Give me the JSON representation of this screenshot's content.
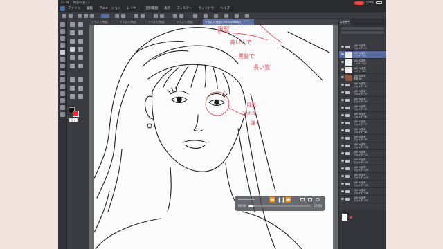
{
  "status_bar": {
    "time": "23:24",
    "date": "9月25日(土)",
    "battery": "100%"
  },
  "menu": [
    "ファイル",
    "編集",
    "アニメーション",
    "レイヤー",
    "選択範囲",
    "表示",
    "フィルター",
    "ウィンドウ",
    "ヘルプ"
  ],
  "tabs": [
    {
      "label": "イラスト(完成)"
    },
    {
      "label": "イラスト(完成)"
    },
    {
      "label": "イラスト(完成)"
    },
    {
      "label": "イラスト(完成)"
    },
    {
      "label": "イラスト(完成)(1920x1080px)"
    }
  ],
  "palette": {
    "tabs": [
      "レイヤー",
      "",
      "",
      ""
    ]
  },
  "layers": [
    {
      "line1": "100 % 通常",
      "line2": "フォルダー 1",
      "type": "folder",
      "selected": false
    },
    {
      "line1": "100 % 通常",
      "line2": "レイヤー 24",
      "type": "layer",
      "selected": true
    },
    {
      "line1": "100 % 通常",
      "line2": "レイヤー 23",
      "type": "layer",
      "selected": false
    },
    {
      "line1": "100 % 通常",
      "line2": "レイヤー 22",
      "type": "layer",
      "selected": false
    },
    {
      "line1": "100 % 通常",
      "line2": "写真 16",
      "type": "photo",
      "selected": false
    },
    {
      "line1": "100 % 通常",
      "line2": "フォルダー 2",
      "type": "folder",
      "selected": false
    },
    {
      "line1": "100 % 通常",
      "line2": "フォルダー 3",
      "type": "folder",
      "selected": false
    },
    {
      "line1": "100 % 通常",
      "line2": "フォルダー 4",
      "type": "folder",
      "selected": false
    },
    {
      "line1": "100 % 通常",
      "line2": "フォルダー 5",
      "type": "folder",
      "selected": false
    },
    {
      "line1": "100 % 通常",
      "line2": "フォルダー 6",
      "type": "folder",
      "selected": false
    },
    {
      "line1": "100 % 通常",
      "line2": "フォルダー 7",
      "type": "folder",
      "selected": false
    },
    {
      "line1": "100 % 通常",
      "line2": "フォルダー 8",
      "type": "folder",
      "selected": false
    },
    {
      "line1": "100 % 通常",
      "line2": "フォルダー 9",
      "type": "folder",
      "selected": false
    },
    {
      "line1": "100 % 通常",
      "line2": "フォルダー 10",
      "type": "folder",
      "selected": false
    },
    {
      "line1": "100 % 通常",
      "line2": "フォルダー 11",
      "type": "folder",
      "selected": false
    },
    {
      "line1": "100 % 通常",
      "line2": "フォルダー 12",
      "type": "folder",
      "selected": false
    },
    {
      "line1": "100 % 通常",
      "line2": "フォルダー 13",
      "type": "folder",
      "selected": false
    },
    {
      "line1": "100 % 通常",
      "line2": "フォルダー 14",
      "type": "folder",
      "selected": false
    },
    {
      "line1": "100 % 通常",
      "line2": "フォルダー 15",
      "type": "folder",
      "selected": false
    },
    {
      "line1": "100 % 通常",
      "line2": "フォルダー 16",
      "type": "folder",
      "selected": false
    },
    {
      "line1": "100 % 通常",
      "line2": "フォルダー 17",
      "type": "folder",
      "selected": false
    }
  ],
  "annotations": {
    "top": [
      "黒髪",
      "高い人で",
      "黒髪で",
      "長い猫"
    ],
    "eye_note": [
      "目尻",
      "(たれ目)",
      "強く"
    ]
  },
  "colors": {
    "main": "#111111",
    "sub": "#e8353b",
    "annotation": "#d6505a",
    "accent": "#5d6fa3"
  },
  "video": {
    "time_start": "00:00",
    "time_end": "17:53",
    "progress": 0.08
  }
}
